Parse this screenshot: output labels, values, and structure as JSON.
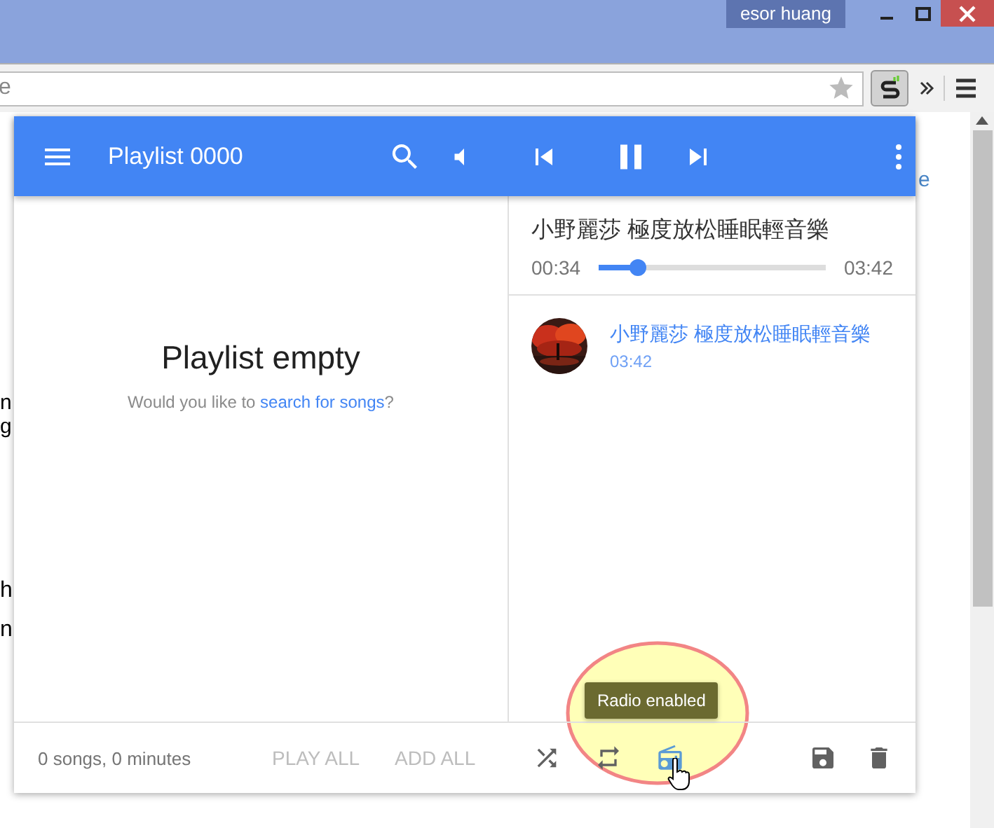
{
  "window": {
    "user": "esor huang"
  },
  "toolbar": {
    "address": "e"
  },
  "background_page": {
    "link_fragment": "e",
    "left_fragments": [
      "n",
      "g",
      "h",
      "n"
    ]
  },
  "player": {
    "title": "Playlist 0000",
    "playing": true,
    "empty": {
      "title": "Playlist empty",
      "before": "Would you like to ",
      "link": "search for songs",
      "after": "?"
    },
    "now_playing": {
      "title": "小野麗莎 極度放松睡眠輕音樂",
      "elapsed": "00:34",
      "duration": "03:42",
      "level": 0.17
    },
    "queue": [
      {
        "title": "小野麗莎 極度放松睡眠輕音樂",
        "duration": "03:42",
        "kind": "picture"
      }
    ],
    "footer": {
      "summary": "0 songs, 0 minutes",
      "actions": [
        {
          "label": "PLAY ALL",
          "disabled": true
        },
        {
          "label": "ADD ALL",
          "disabled": true
        }
      ],
      "toggles": [
        {
          "kind": "shuffle",
          "on": false
        },
        {
          "kind": "repeat",
          "on": false
        },
        {
          "kind": "radio",
          "on": true
        }
      ]
    },
    "tooltip": "Radio enabled"
  }
}
